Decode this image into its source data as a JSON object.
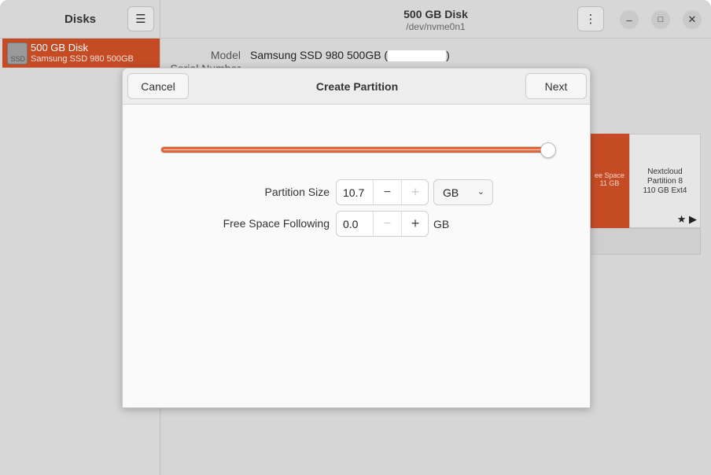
{
  "app": {
    "sidebar_title": "Disks",
    "header_title": "500 GB Disk",
    "header_subtitle": "/dev/nvme0n1"
  },
  "sidebar": {
    "disks": [
      {
        "name": "500 GB Disk",
        "subtitle": "Samsung SSD 980 500GB",
        "icon_text": "SSD",
        "selected": true
      }
    ]
  },
  "disk_info": {
    "model_label": "Model",
    "model_value": "Samsung SSD 980 500GB (",
    "model_value_end": ")",
    "serial_label": "Serial Number"
  },
  "volumes": {
    "free_space_label": "ee Space",
    "free_space_size": "11 GB",
    "partition_name": "Nextcloud",
    "partition_label": "Partition 8",
    "partition_desc": "110 GB Ext4"
  },
  "dialog": {
    "title": "Create Partition",
    "cancel_label": "Cancel",
    "next_label": "Next",
    "slider_fraction": 1.0,
    "partition_size_label": "Partition Size",
    "partition_size_value": "10.7",
    "partition_size_unit": "GB",
    "free_space_label": "Free Space Following",
    "free_space_value": "0.0",
    "free_space_unit": "GB"
  },
  "colors": {
    "accent": "#c54b24",
    "slider": "#e8693a"
  }
}
